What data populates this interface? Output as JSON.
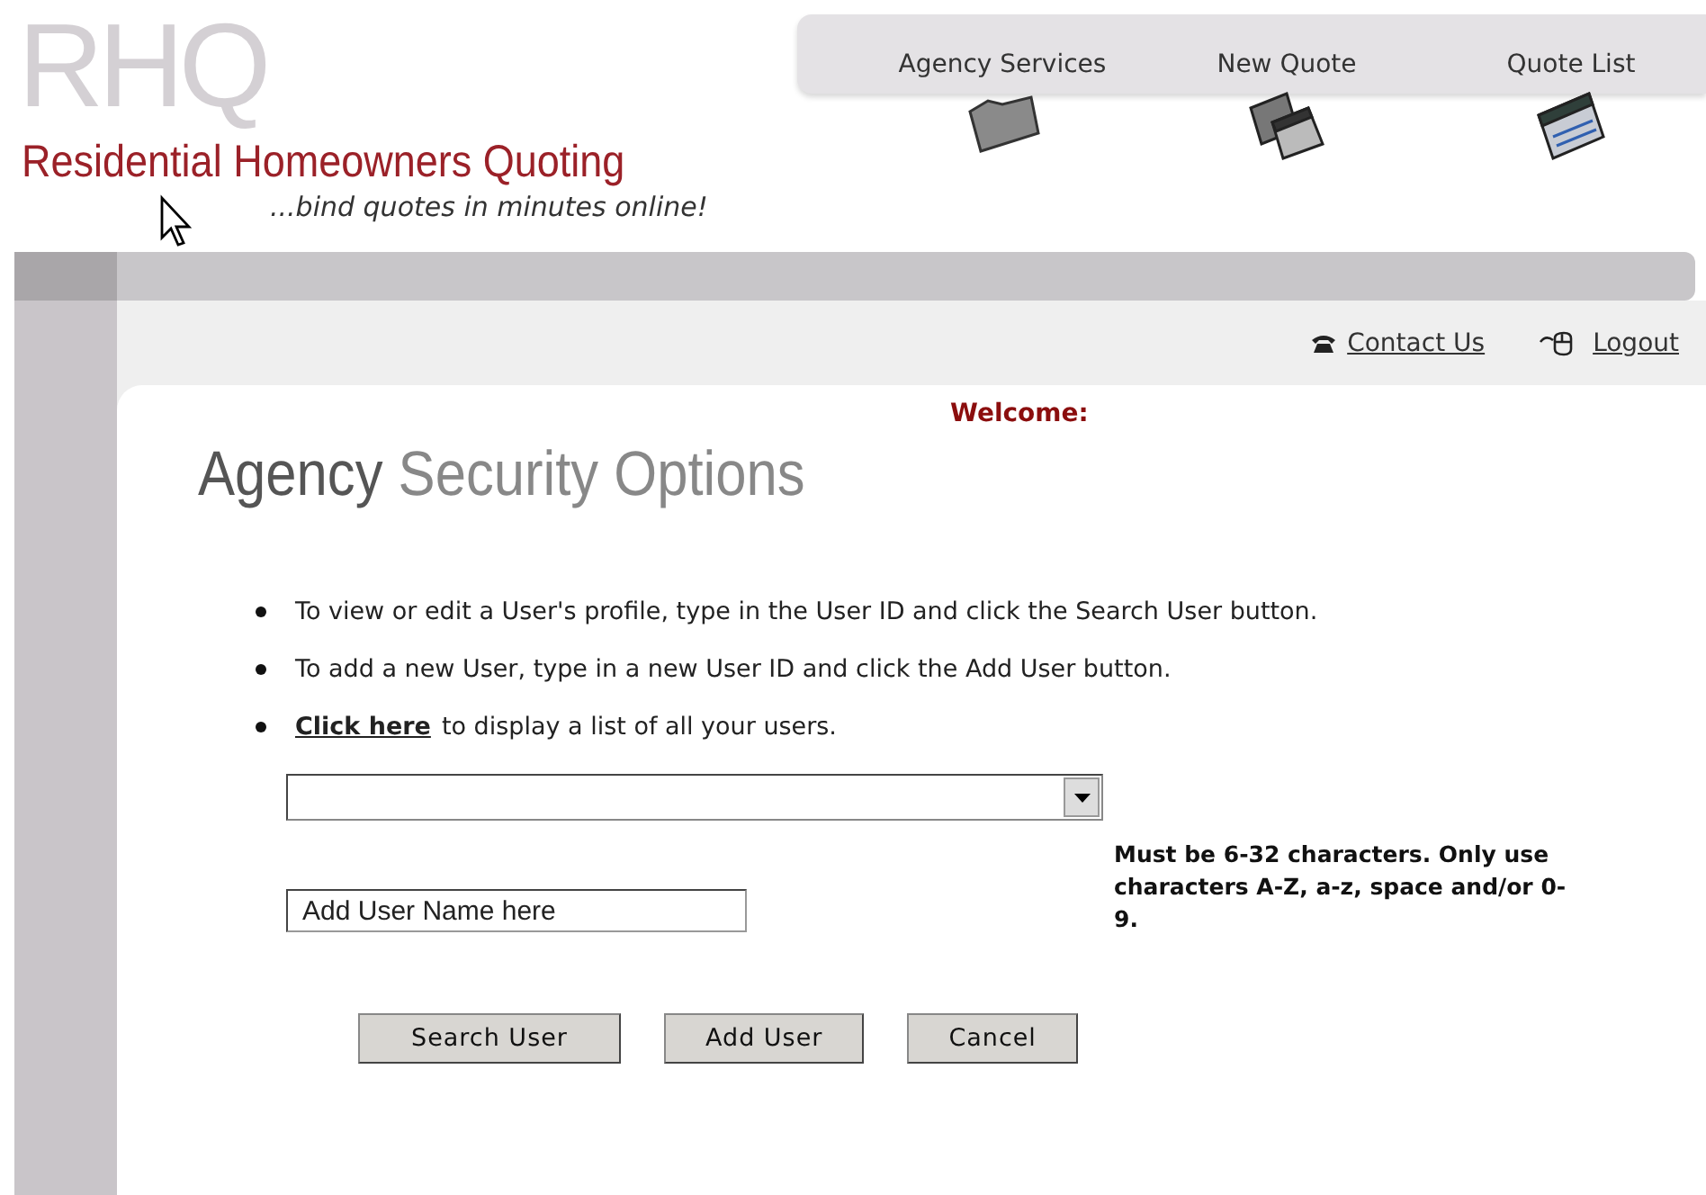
{
  "header": {
    "logo_letters": "RHQ",
    "title": "Residential Homeowners Quoting",
    "tagline": "...bind quotes in minutes online!"
  },
  "nav": [
    {
      "label": "Agency Services",
      "kind": "folder"
    },
    {
      "label": "New Quote",
      "kind": "windows"
    },
    {
      "label": "Quote List",
      "kind": "list"
    }
  ],
  "links": [
    {
      "label": "Contact Us",
      "kind": "phone"
    },
    {
      "label": "Logout",
      "kind": "mouse"
    }
  ],
  "welcome": "Welcome:",
  "page_title": {
    "first": "Agency",
    "rest": "Security Options"
  },
  "instructions": [
    {
      "text": "To view or edit a User's profile, type in the User ID and click the Search User button."
    },
    {
      "text": "To add a new User, type in a new User ID and click the Add User button."
    },
    {
      "link": "Click here",
      "text": "to display a list of all your users."
    }
  ],
  "user_name_field": {
    "value": "Add User Name here"
  },
  "hint": "Must be 6-32 characters. Only use characters A-Z, a-z, space and/or 0-9.",
  "buttons": [
    "Search User",
    "Add User",
    "Cancel"
  ]
}
